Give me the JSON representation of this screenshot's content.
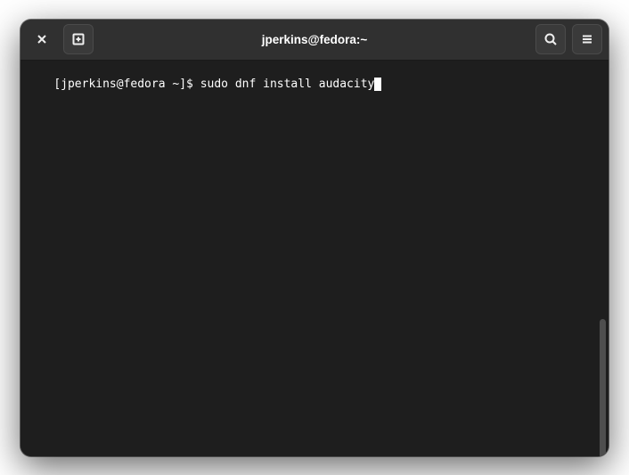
{
  "window": {
    "title": "jperkins@fedora:~"
  },
  "terminal": {
    "prompt": "[jperkins@fedora ~]$ ",
    "command": "sudo dnf install audacity"
  }
}
